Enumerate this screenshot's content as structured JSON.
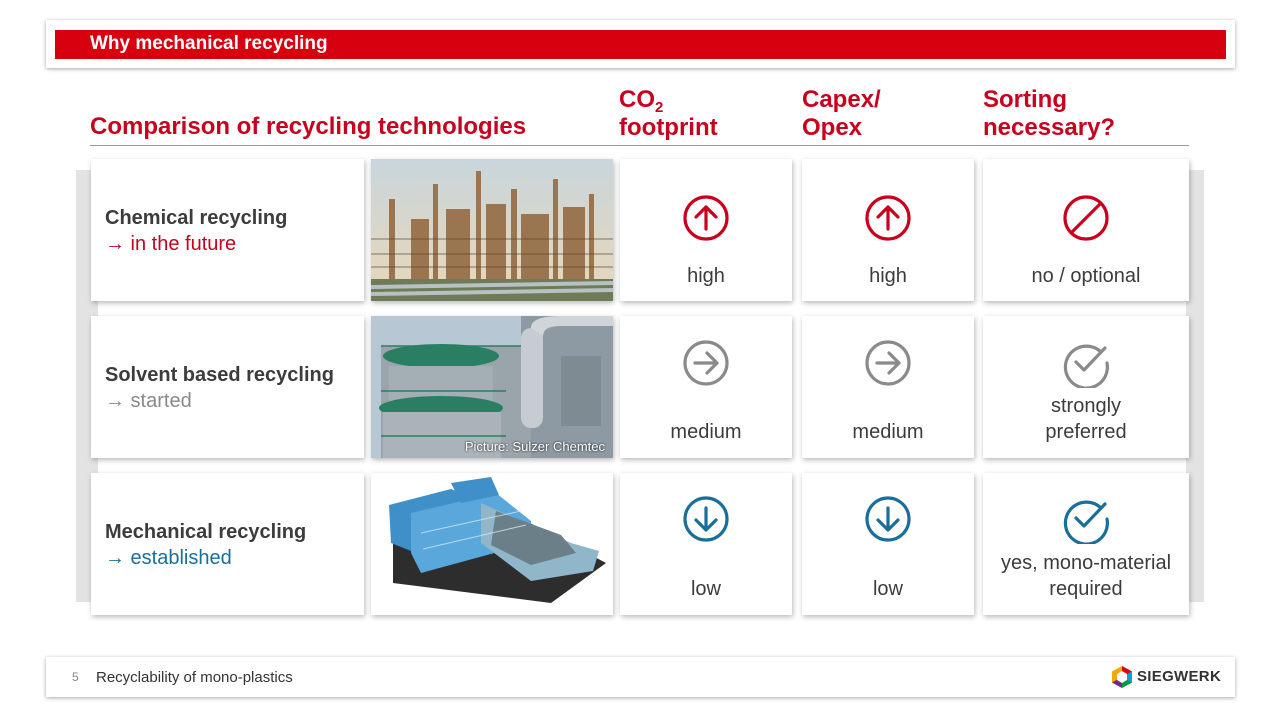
{
  "header": {
    "title": "Why mechanical recycling"
  },
  "table": {
    "title": "Comparison of recycling technologies",
    "columns": {
      "co2_main": "CO",
      "co2_sub": "2",
      "co2_line2": "footprint",
      "capex_line1": "Capex/",
      "capex_line2": "Opex",
      "sorting_line1": "Sorting",
      "sorting_line2": "necessary?"
    },
    "rows": [
      {
        "title": "Chemical recycling",
        "status": "→ in the future",
        "status_color": "#c8001e",
        "co2": "high",
        "capex": "high",
        "sorting": "no / optional",
        "co2_icon": "arrow-up-circle-icon",
        "capex_icon": "arrow-up-circle-icon",
        "sorting_icon": "prohibited-icon"
      },
      {
        "title": "Solvent based recycling",
        "status": "→ started",
        "status_color": "#8a8a8a",
        "co2": "medium",
        "capex": "medium",
        "sorting_line1": "strongly",
        "sorting_line2": "preferred",
        "photo_caption": "Picture: Sulzer Chemtec",
        "co2_icon": "arrow-right-circle-icon",
        "capex_icon": "arrow-right-circle-icon",
        "sorting_icon": "check-circle-icon"
      },
      {
        "title": "Mechanical recycling",
        "status": "→ established",
        "status_color": "#1a6f9a",
        "co2": "low",
        "capex": "low",
        "sorting_line1": "yes, mono-material",
        "sorting_line2": "required",
        "co2_icon": "arrow-down-circle-icon",
        "capex_icon": "arrow-down-circle-icon",
        "sorting_icon": "check-circle-icon"
      }
    ],
    "colors": {
      "high": "#c8001e",
      "medium": "#8a8a8a",
      "low": "#1a6f9a"
    }
  },
  "footer": {
    "page_number": "5",
    "text": "Recyclability of mono-plastics",
    "brand": "SIEGWERK"
  }
}
